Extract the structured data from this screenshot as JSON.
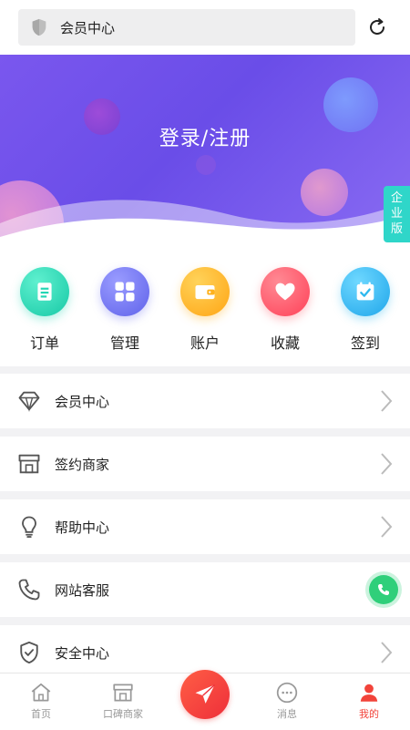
{
  "header": {
    "search_label": "会员中心"
  },
  "hero": {
    "login_text": "登录/注册",
    "enterprise_badge": [
      "企",
      "业",
      "版"
    ]
  },
  "quick_actions": [
    {
      "label": "订单",
      "icon": "clipboard-icon",
      "color": "#24d6b4"
    },
    {
      "label": "管理",
      "icon": "grid-icon",
      "color": "#6f72f0"
    },
    {
      "label": "账户",
      "icon": "wallet-icon",
      "color": "#ffb21e"
    },
    {
      "label": "收藏",
      "icon": "heart-icon",
      "color": "#ff5b6b"
    },
    {
      "label": "签到",
      "icon": "calendar-check-icon",
      "color": "#2fb9ef"
    }
  ],
  "menu": [
    {
      "label": "会员中心",
      "icon": "diamond-icon"
    },
    {
      "label": "签约商家",
      "icon": "store-icon"
    },
    {
      "label": "帮助中心",
      "icon": "lightbulb-icon"
    },
    {
      "label": "网站客服",
      "icon": "phone-icon"
    },
    {
      "label": "安全中心",
      "icon": "shield-check-icon"
    }
  ],
  "bottom_nav": [
    {
      "label": "首页",
      "icon": "home-icon"
    },
    {
      "label": "口碑商家",
      "icon": "store-icon"
    },
    {
      "label": "消息",
      "icon": "chat-icon"
    },
    {
      "label": "我的",
      "icon": "user-icon",
      "active": true
    }
  ],
  "colors": {
    "accent_red": "#f2433a",
    "hero_purple": "#6a4de8",
    "enterprise_teal": "#2fd6c9"
  }
}
